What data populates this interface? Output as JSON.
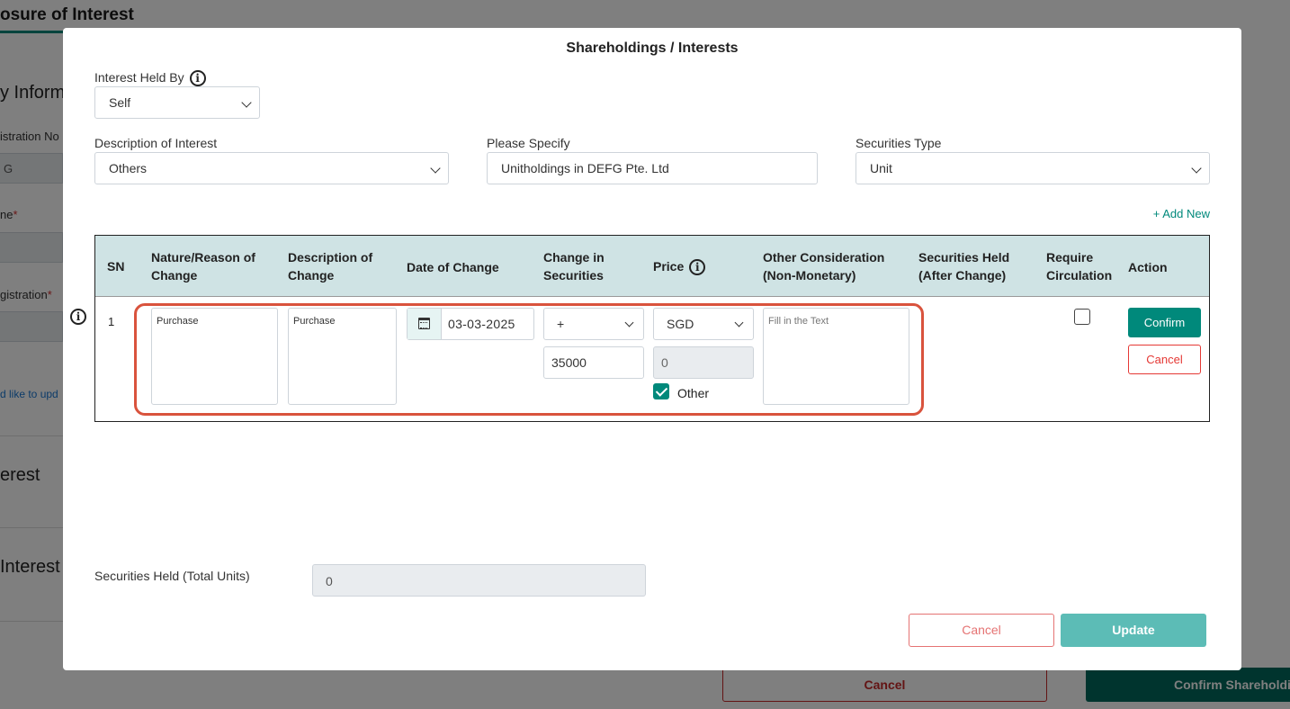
{
  "background": {
    "page_title": "osure of Interest",
    "section_info": "y Inform",
    "label_registration_no": "istration No",
    "input_registration_value": "G",
    "label_name": "ne",
    "label_registration": "gistration",
    "required_mark": "*",
    "update_link": "d like to upd",
    "section_interest": "erest",
    "section_interest2": "Interest",
    "cancel_button": "Cancel",
    "confirm_button": "Confirm Shareholdi"
  },
  "modal": {
    "title": "Shareholdings / Interests",
    "interest_held_by": {
      "label": "Interest Held By",
      "value": "Self"
    },
    "description_of_interest": {
      "label": "Description of Interest",
      "value": "Others"
    },
    "please_specify": {
      "label": "Please Specify",
      "value": "Unitholdings in DEFG Pte. Ltd"
    },
    "securities_type": {
      "label": "Securities Type",
      "value": "Unit"
    },
    "add_new": "+ Add New",
    "table": {
      "headers": {
        "sn": "SN",
        "nature": "Nature/Reason of Change",
        "description": "Description of Change",
        "date": "Date of Change",
        "change": "Change in Securities",
        "price": "Price",
        "other_consideration": "Other Consideration (Non-Monetary)",
        "securities_held": "Securities Held (After Change)",
        "require_circulation": "Require Circulation",
        "action": "Action"
      },
      "row": {
        "sn": "1",
        "nature": "Purchase",
        "description": "Purchase",
        "date": "03-03-2025",
        "change_sign": "+",
        "change_amount": "35000",
        "currency": "SGD",
        "price_value": "0",
        "other_checked": true,
        "other_label": "Other",
        "other_consideration_placeholder": "Fill in the Text",
        "require_circulation_checked": false,
        "confirm_label": "Confirm",
        "cancel_label": "Cancel"
      }
    },
    "total_units": {
      "label": "Securities Held (Total Units)",
      "value": "0"
    },
    "footer": {
      "cancel": "Cancel",
      "update": "Update"
    }
  },
  "colors": {
    "accent": "#00897b",
    "header_bg": "#cfe3e4",
    "highlight": "#d9533d",
    "danger": "#e53935",
    "update_disabled": "#5cbcb6"
  },
  "icons": [
    "info-icon",
    "calendar-icon",
    "chevron-down-icon",
    "checkmark-icon"
  ]
}
